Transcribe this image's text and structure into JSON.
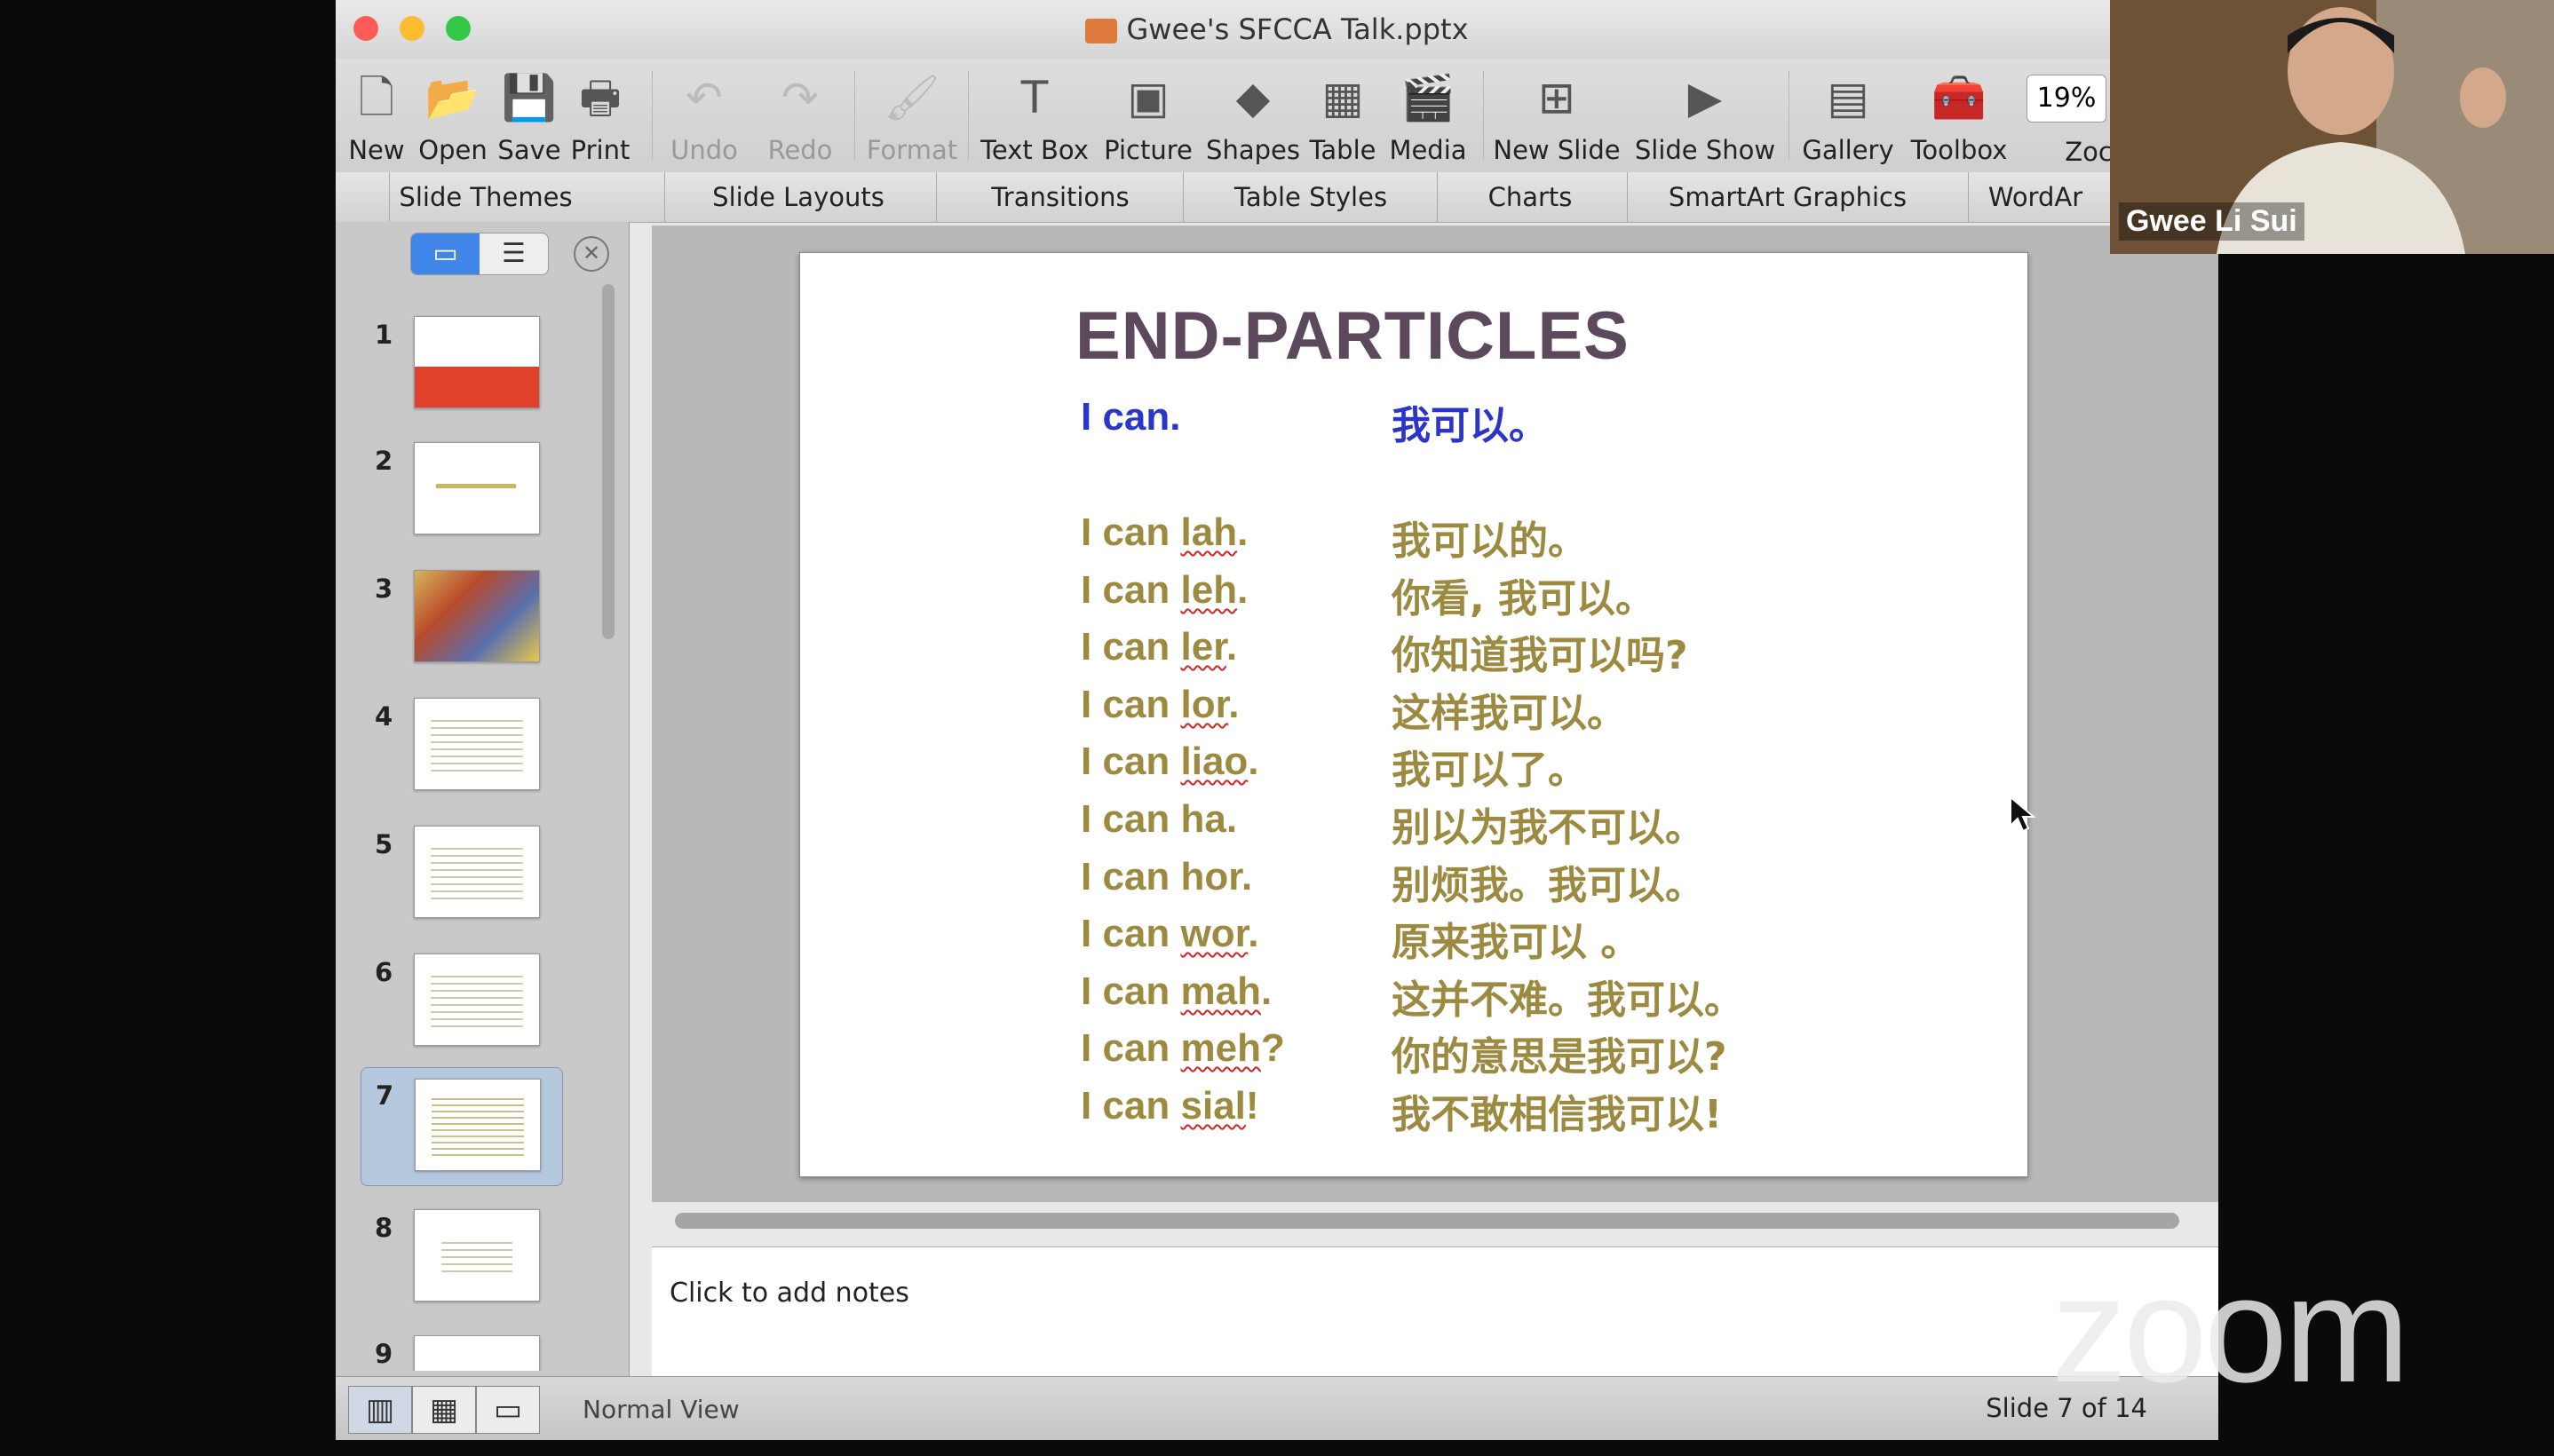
{
  "window": {
    "title": "Gwee's SFCCA Talk.pptx"
  },
  "toolbar": {
    "items": [
      {
        "label": "New",
        "icon": "new-doc-icon"
      },
      {
        "label": "Open",
        "icon": "open-icon"
      },
      {
        "label": "Save",
        "icon": "save-icon"
      },
      {
        "label": "Print",
        "icon": "print-icon"
      },
      {
        "label": "Undo",
        "icon": "undo-icon"
      },
      {
        "label": "Redo",
        "icon": "redo-icon"
      },
      {
        "label": "Format",
        "icon": "format-brush-icon"
      },
      {
        "label": "Text Box",
        "icon": "text-box-icon"
      },
      {
        "label": "Picture",
        "icon": "picture-icon"
      },
      {
        "label": "Shapes",
        "icon": "shapes-icon"
      },
      {
        "label": "Table",
        "icon": "table-icon"
      },
      {
        "label": "Media",
        "icon": "media-icon"
      },
      {
        "label": "New Slide",
        "icon": "new-slide-icon"
      },
      {
        "label": "Slide Show",
        "icon": "slide-show-icon"
      },
      {
        "label": "Gallery",
        "icon": "gallery-icon"
      },
      {
        "label": "Toolbox",
        "icon": "toolbox-icon"
      },
      {
        "label": "Zoc",
        "icon": "zoom-field"
      }
    ],
    "zoom_value": "19%"
  },
  "ribbon": {
    "tabs": [
      "Slide Themes",
      "Slide Layouts",
      "Transitions",
      "Table Styles",
      "Charts",
      "SmartArt Graphics",
      "WordAr"
    ]
  },
  "thumbnails": {
    "numbers": [
      "1",
      "2",
      "3",
      "4",
      "5",
      "6",
      "7",
      "8",
      "9"
    ],
    "selected": "7"
  },
  "slide": {
    "title": "END-PARTICLES",
    "header_en": "I can.",
    "header_zh": "我可以。",
    "rows": [
      {
        "prefix": "I can ",
        "particle": "lah",
        "suffix": ".",
        "zh": "我可以的。"
      },
      {
        "prefix": "I can ",
        "particle": "leh",
        "suffix": ".",
        "zh": "你看, 我可以。"
      },
      {
        "prefix": "I can ",
        "particle": "ler",
        "suffix": ".",
        "zh": "你知道我可以吗?"
      },
      {
        "prefix": "I can ",
        "particle": "lor",
        "suffix": ".",
        "zh": "这样我可以。"
      },
      {
        "prefix": "I can ",
        "particle": "liao",
        "suffix": ".",
        "zh": "我可以了。"
      },
      {
        "prefix": "I can ",
        "particle": "ha",
        "suffix": ".",
        "zh": "别以为我不可以。"
      },
      {
        "prefix": "I can ",
        "particle": "hor",
        "suffix": ".",
        "zh": "别烦我。我可以。"
      },
      {
        "prefix": "I can ",
        "particle": "wor",
        "suffix": ".",
        "zh": "原来我可以 。"
      },
      {
        "prefix": "I can ",
        "particle": "mah",
        "suffix": ".",
        "zh": "这并不难。我可以。"
      },
      {
        "prefix": "I can ",
        "particle": "meh",
        "suffix": "?",
        "zh": "你的意思是我可以?"
      },
      {
        "prefix": "I can ",
        "particle": "sial",
        "suffix": "!",
        "zh": "我不敢相信我可以!"
      }
    ]
  },
  "notes": {
    "placeholder": "Click to add notes"
  },
  "status": {
    "view": "Normal View",
    "slide_count": "Slide 7 of 14"
  },
  "zoom_overlay": {
    "participant_name": "Gwee Li Sui",
    "logo": "zoom"
  },
  "colors": {
    "title": "#5c4a5c",
    "body": "#9c8a40",
    "highlight_blue": "#2b36c9",
    "selection_blue": "#3f86e8"
  }
}
